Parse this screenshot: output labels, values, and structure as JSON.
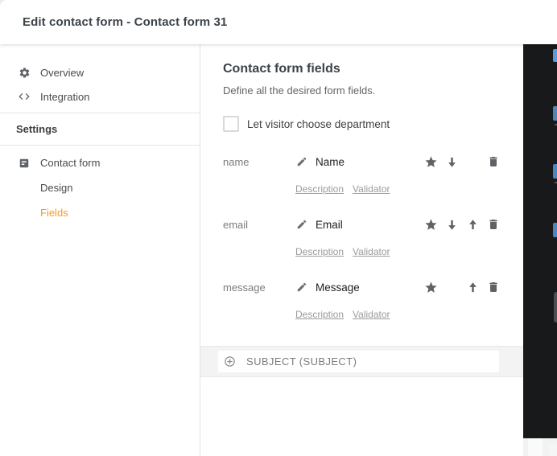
{
  "window": {
    "title": "Edit contact form - Contact form 31"
  },
  "sidebar": {
    "items": [
      {
        "label": "Overview",
        "icon": "gear-icon"
      },
      {
        "label": "Integration",
        "icon": "code-icon"
      }
    ],
    "section": {
      "label": "Settings"
    },
    "settings_items": [
      {
        "label": "Contact form",
        "icon": "form-icon",
        "active": false
      },
      {
        "label": "Design",
        "icon": null,
        "active": false
      },
      {
        "label": "Fields",
        "icon": null,
        "active": true
      }
    ],
    "active_color": "#f79a1f"
  },
  "main": {
    "title": "Contact form fields",
    "subtitle": "Define all the desired form fields.",
    "department_checkbox": {
      "label": "Let visitor choose department",
      "checked": false
    },
    "fields": [
      {
        "key": "name",
        "label": "Name",
        "links": [
          "Description",
          "Validator"
        ],
        "can_move_up": false,
        "can_move_down": true
      },
      {
        "key": "email",
        "label": "Email",
        "links": [
          "Description",
          "Validator"
        ],
        "can_move_up": true,
        "can_move_down": true
      },
      {
        "key": "message",
        "label": "Message",
        "links": [
          "Description",
          "Validator"
        ],
        "can_move_up": true,
        "can_move_down": false
      }
    ],
    "add_field_row": {
      "label": "SUBJECT (SUBJECT)",
      "icon": "plus-circle-icon"
    }
  },
  "colors": {
    "backdrop_dark": "#17191b",
    "band_gray": "#f3f3f3",
    "icon_gray": "#5f6368"
  }
}
